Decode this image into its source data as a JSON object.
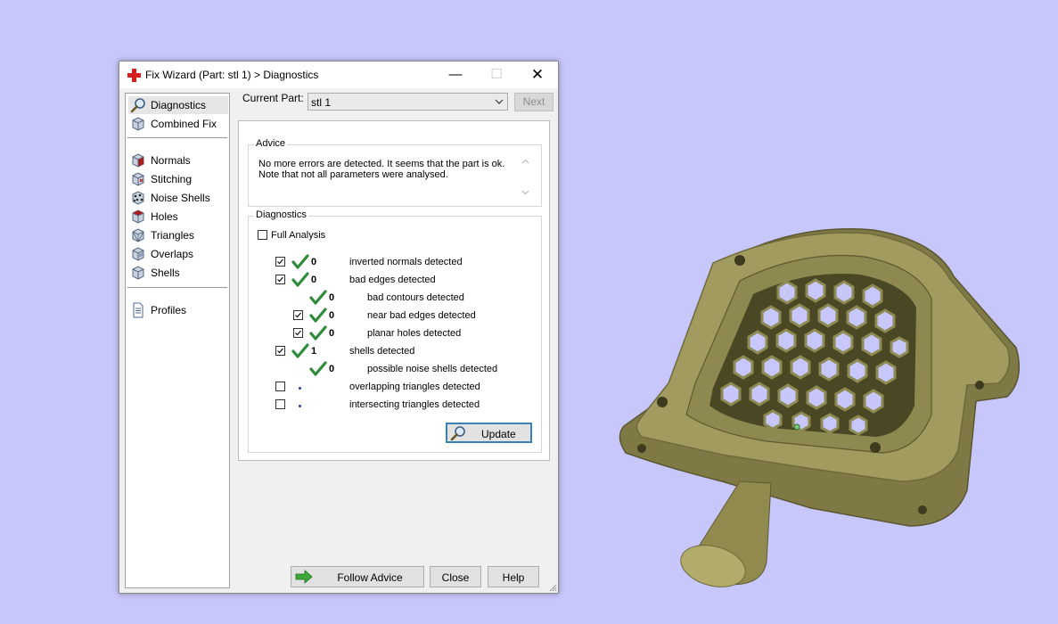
{
  "window": {
    "title": "Fix Wizard (Part: stl 1) > Diagnostics",
    "minimize_glyph": "—",
    "maximize_glyph": "☐",
    "close_glyph": "✕"
  },
  "nav": {
    "top_items": [
      {
        "label": "Diagnostics",
        "icon": "magnifier-icon",
        "selected": true
      },
      {
        "label": "Combined Fix",
        "icon": "cube-icon"
      }
    ],
    "fix_items": [
      {
        "label": "Normals",
        "icon": "normals-cube-icon"
      },
      {
        "label": "Stitching",
        "icon": "stitching-cube-icon"
      },
      {
        "label": "Noise Shells",
        "icon": "noise-shells-icon"
      },
      {
        "label": "Holes",
        "icon": "holes-cube-icon"
      },
      {
        "label": "Triangles",
        "icon": "triangles-cube-icon"
      },
      {
        "label": "Overlaps",
        "icon": "overlaps-cube-icon"
      },
      {
        "label": "Shells",
        "icon": "shells-cube-icon"
      }
    ],
    "bottom_items": [
      {
        "label": "Profiles",
        "icon": "document-icon"
      }
    ]
  },
  "current_part": {
    "label": "Current Part:",
    "value": "stl 1",
    "next_label": "Next"
  },
  "advice": {
    "title": "Advice",
    "line1": "No more errors are detected. It seems that the part is ok.",
    "line2": "Note that not all parameters were analysed."
  },
  "diagnostics": {
    "title": "Diagnostics",
    "full_analysis_label": "Full Analysis",
    "full_analysis_checked": false,
    "rows": [
      {
        "checkbox": true,
        "checked": true,
        "status": "ok",
        "count": "0",
        "label": "inverted normals detected",
        "indent": 0
      },
      {
        "checkbox": true,
        "checked": true,
        "status": "ok",
        "count": "0",
        "label": "bad edges detected",
        "indent": 0
      },
      {
        "checkbox": false,
        "checked": false,
        "status": "ok",
        "count": "0",
        "label": "bad contours detected",
        "indent": 1
      },
      {
        "checkbox": true,
        "checked": true,
        "status": "ok",
        "count": "0",
        "label": "near bad edges detected",
        "indent": 1
      },
      {
        "checkbox": true,
        "checked": true,
        "status": "ok",
        "count": "0",
        "label": "planar holes detected",
        "indent": 1
      },
      {
        "checkbox": true,
        "checked": true,
        "status": "ok",
        "count": "1",
        "label": "shells detected",
        "indent": 0
      },
      {
        "checkbox": false,
        "checked": false,
        "status": "ok",
        "count": "0",
        "label": "possible noise shells detected",
        "indent": 1
      },
      {
        "checkbox": true,
        "checked": false,
        "status": "not-analysed",
        "count": "",
        "label": "overlapping triangles detected",
        "indent": 0
      },
      {
        "checkbox": true,
        "checked": false,
        "status": "not-analysed",
        "count": "",
        "label": "intersecting triangles detected",
        "indent": 0
      }
    ],
    "update_label": "Update"
  },
  "buttons": {
    "follow_advice": "Follow Advice",
    "close": "Close",
    "help": "Help"
  },
  "colors": {
    "background": "#c7c7fb",
    "model": "#8f8a52",
    "check_green": "#2e8b3a",
    "update_border": "#3c7fb1"
  }
}
